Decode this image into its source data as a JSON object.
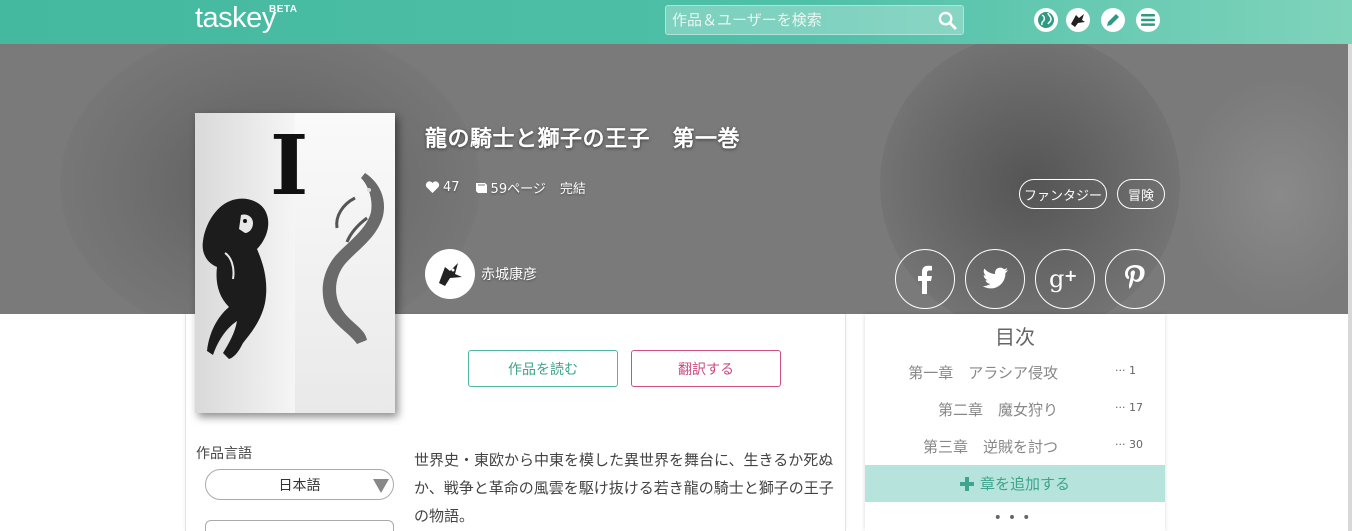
{
  "app": {
    "logo": "taskey",
    "beta": "BETA"
  },
  "search": {
    "placeholder": "作品＆ユーザーを検索"
  },
  "nav_icons": [
    "globe-icon",
    "dragon-avatar-icon",
    "pencil-icon",
    "menu-icon"
  ],
  "work": {
    "title": "龍の騎士と獅子の王子　第一巻",
    "likes": "47",
    "pages": "59ページ",
    "status": "完結",
    "tags": [
      "ファンタジー",
      "冒険"
    ],
    "author": "赤城康彦",
    "cover_numeral": "I",
    "description": "世界史・東欧から中東を模した異世界を舞台に、生きるか死ぬか、戦争と革命の風雲を駆け抜ける若き龍の騎士と獅子の王子の物語。"
  },
  "share": [
    "facebook-icon",
    "twitter-icon",
    "google-plus-icon",
    "pinterest-icon"
  ],
  "buttons": {
    "read": "作品を読む",
    "translate": "翻訳する"
  },
  "language": {
    "label": "作品言語",
    "selected": "日本語"
  },
  "toc": {
    "title": "目次",
    "chapters": [
      {
        "name": "第一章　アラシア侵攻",
        "page": "1"
      },
      {
        "name": "第二章　魔女狩り",
        "page": "17"
      },
      {
        "name": "第三章　逆賊を討つ",
        "page": "30"
      }
    ],
    "add_label": "章を追加する",
    "more": "•••"
  },
  "colors": {
    "brand": "#4fc0a8",
    "read_button": "#3ea48e",
    "translate_button": "#cc4a80",
    "toc_add_bg": "#b6e3dc"
  }
}
